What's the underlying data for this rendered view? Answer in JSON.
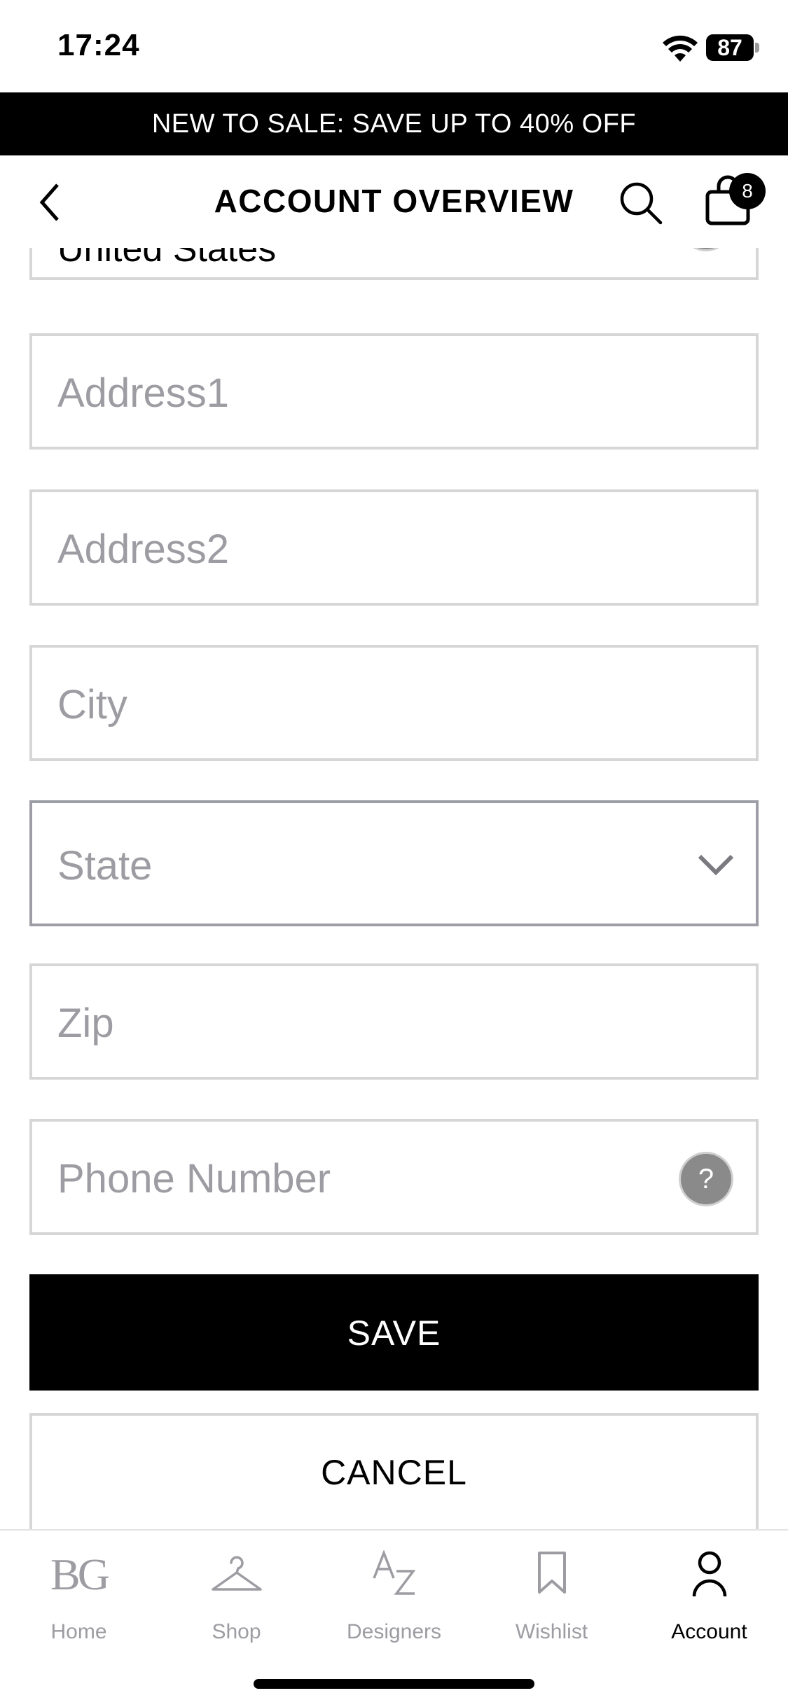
{
  "status_bar": {
    "time": "17:24",
    "battery": "87"
  },
  "promo_banner": {
    "text": "NEW TO SALE: SAVE UP TO 40% OFF"
  },
  "header": {
    "title": "ACCOUNT OVERVIEW",
    "bag_count": "8"
  },
  "form": {
    "country_value": "United States",
    "address1_placeholder": "Address1",
    "address2_placeholder": "Address2",
    "city_placeholder": "City",
    "state_placeholder": "State",
    "zip_placeholder": "Zip",
    "phone_placeholder": "Phone Number",
    "help_glyph": "?",
    "save_label": "SAVE",
    "cancel_label": "CANCEL"
  },
  "tab_bar": {
    "items": [
      {
        "label": "Home",
        "icon": "bg-logo-icon",
        "logo_text": "BG",
        "active": false
      },
      {
        "label": "Shop",
        "icon": "hanger-icon",
        "active": false
      },
      {
        "label": "Designers",
        "icon": "az-icon",
        "active": false
      },
      {
        "label": "Wishlist",
        "icon": "bookmark-icon",
        "active": false
      },
      {
        "label": "Account",
        "icon": "person-icon",
        "active": true
      }
    ]
  },
  "colors": {
    "banner_bg": "#000000",
    "placeholder": "#9c9ca2",
    "field_border": "#d6d6d6",
    "focused_border": "#9d9da6",
    "help_icon_bg": "#8a8a8a"
  }
}
